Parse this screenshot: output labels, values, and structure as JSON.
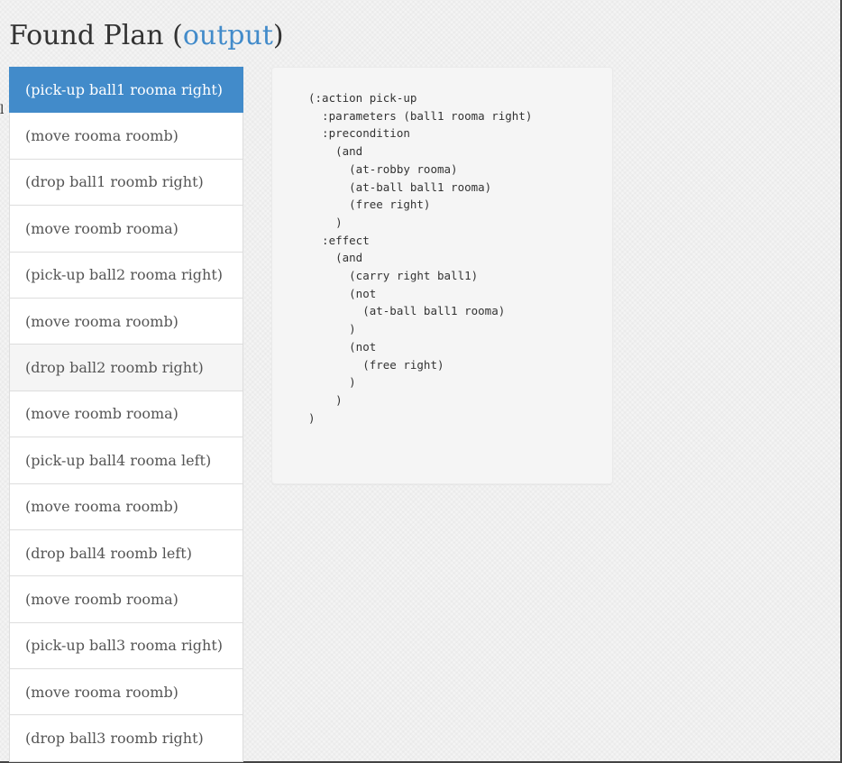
{
  "header": {
    "title_prefix": "Found Plan (",
    "title_link": "output",
    "title_suffix": ")"
  },
  "stray_text": "l",
  "plan": {
    "active_index": 0,
    "hover_index": 6,
    "steps": [
      "(pick-up ball1 rooma right)",
      "(move rooma roomb)",
      "(drop ball1 roomb right)",
      "(move roomb rooma)",
      "(pick-up ball2 rooma right)",
      "(move rooma roomb)",
      "(drop ball2 roomb right)",
      "(move roomb rooma)",
      "(pick-up ball4 rooma left)",
      "(move rooma roomb)",
      "(drop ball4 roomb left)",
      "(move roomb rooma)",
      "(pick-up ball3 rooma right)",
      "(move rooma roomb)",
      "(drop ball3 roomb right)"
    ]
  },
  "action_detail": {
    "code": "(:action pick-up\n  :parameters (ball1 rooma right)\n  :precondition\n    (and\n      (at-robby rooma)\n      (at-ball ball1 rooma)\n      (free right)\n    )\n  :effect\n    (and\n      (carry right ball1)\n      (not\n        (at-ball ball1 rooma)\n      )\n      (not\n        (free right)\n      )\n    )\n)"
  },
  "colors": {
    "accent": "#428bca",
    "text": "#333333",
    "item_text": "#555555",
    "panel_bg": "#f5f5f5"
  }
}
